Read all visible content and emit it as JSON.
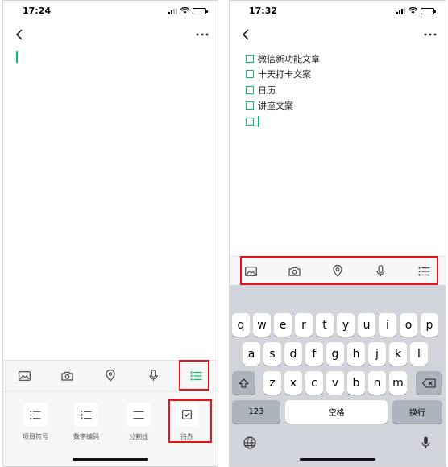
{
  "left_screen": {
    "status_time": "17:24",
    "toolbar": [
      {
        "name": "image-icon"
      },
      {
        "name": "camera-icon"
      },
      {
        "name": "location-pin-icon"
      },
      {
        "name": "microphone-icon"
      },
      {
        "name": "bullet-list-icon",
        "active": true
      }
    ],
    "format_options": [
      {
        "label": "项目符号",
        "icon": "bullet-list-icon"
      },
      {
        "label": "数字编码",
        "icon": "numbered-list-icon"
      },
      {
        "label": "分割线",
        "icon": "divider-icon"
      },
      {
        "label": "待办",
        "icon": "checkbox-icon"
      }
    ]
  },
  "right_screen": {
    "status_time": "17:32",
    "todo_items": [
      {
        "text": "微信新功能文章"
      },
      {
        "text": "十天打卡文案"
      },
      {
        "text": "日历"
      },
      {
        "text": "讲座文案"
      },
      {
        "text": ""
      }
    ],
    "toolbar": [
      {
        "name": "image-icon"
      },
      {
        "name": "camera-icon"
      },
      {
        "name": "location-pin-icon"
      },
      {
        "name": "microphone-icon"
      },
      {
        "name": "bullet-list-icon"
      }
    ],
    "keyboard": {
      "row1": [
        "q",
        "w",
        "e",
        "r",
        "t",
        "y",
        "u",
        "i",
        "o",
        "p"
      ],
      "row2": [
        "a",
        "s",
        "d",
        "f",
        "g",
        "h",
        "j",
        "k",
        "l"
      ],
      "row3": [
        "z",
        "x",
        "c",
        "v",
        "b",
        "n",
        "m"
      ],
      "numbers_key": "123",
      "space_key": "空格",
      "return_key": "换行"
    }
  },
  "colors": {
    "accent_green": "#07c160",
    "highlight_red": "#e3131b",
    "keyboard_bg": "#d1d4db",
    "func_key": "#adb3bc"
  }
}
